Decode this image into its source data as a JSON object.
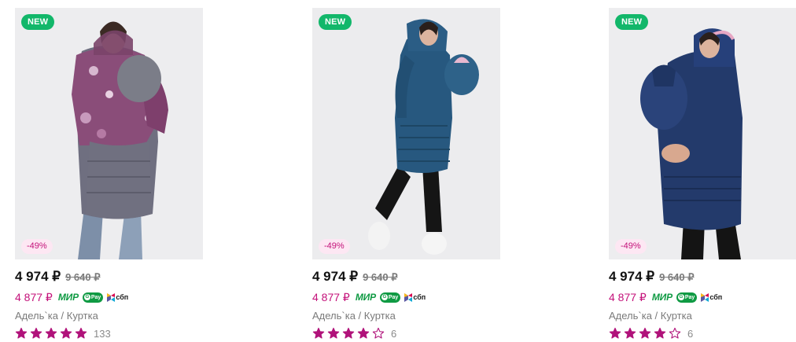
{
  "colors": {
    "accent_pink": "#c4127a",
    "new_badge": "#12b76a",
    "star": "#b0127a"
  },
  "products": [
    {
      "badge_new": "NEW",
      "discount": "-49%",
      "price": "4 974 ₽",
      "old_price": "9 640 ₽",
      "card_price": "4 877 ₽",
      "payment": {
        "mir": "МИР",
        "gpay": "Pay",
        "sbp": "сбп"
      },
      "brand_category": "Адель`ка / Куртка",
      "rating": 5,
      "reviews": "133",
      "image": "woman-floral-maternity-jacket-photo"
    },
    {
      "badge_new": "NEW",
      "discount": "-49%",
      "price": "4 974 ₽",
      "old_price": "9 640 ₽",
      "card_price": "4 877 ₽",
      "payment": {
        "mir": "МИР",
        "gpay": "Pay",
        "sbp": "сбп"
      },
      "brand_category": "Адель`ка / Куртка",
      "rating": 4,
      "reviews": "6",
      "image": "woman-teal-maternity-jacket-photo"
    },
    {
      "badge_new": "NEW",
      "discount": "-49%",
      "price": "4 974 ₽",
      "old_price": "9 640 ₽",
      "card_price": "4 877 ₽",
      "payment": {
        "mir": "МИР",
        "gpay": "Pay",
        "sbp": "сбп"
      },
      "brand_category": "Адель`ка / Куртка",
      "rating": 4,
      "reviews": "6",
      "image": "woman-navy-maternity-jacket-photo"
    }
  ]
}
